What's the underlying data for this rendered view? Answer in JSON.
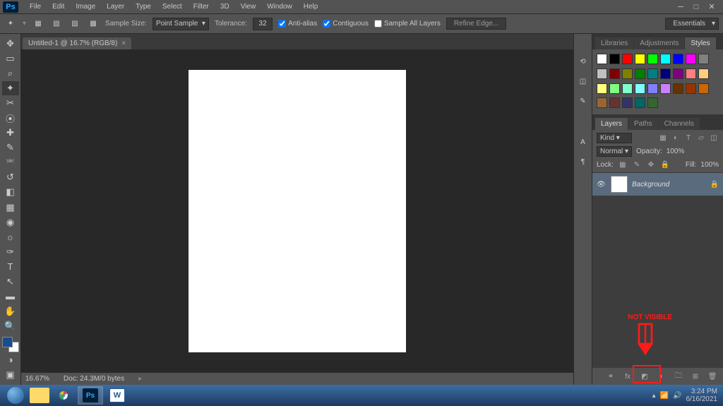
{
  "app": {
    "logo": "Ps"
  },
  "menu": [
    "File",
    "Edit",
    "Image",
    "Layer",
    "Type",
    "Select",
    "Filter",
    "3D",
    "View",
    "Window",
    "Help"
  ],
  "options": {
    "sample_size_label": "Sample Size:",
    "sample_size_value": "Point Sample",
    "tolerance_label": "Tolerance:",
    "tolerance_value": "32",
    "anti_alias": "Anti-alias",
    "contiguous": "Contiguous",
    "sample_all": "Sample All Layers",
    "refine_edge": "Refine Edge...",
    "workspace": "Essentials"
  },
  "document": {
    "tab": "Untitled-1 @ 16.7% (RGB/8)",
    "zoom": "16.67%",
    "doc_info": "Doc: 24.3M/0 bytes"
  },
  "panels": {
    "swatches_tabs": [
      "Libraries",
      "Adjustments",
      "Styles"
    ],
    "swatches_colors": [
      "#ffffff",
      "#000000",
      "#ff0000",
      "#ffff00",
      "#00ff00",
      "#00ffff",
      "#0000ff",
      "#ff00ff",
      "#808080",
      "#c0c0c0",
      "#800000",
      "#808000",
      "#008000",
      "#008080",
      "#000080",
      "#800080",
      "#ff8080",
      "#ffcc80",
      "#ffff80",
      "#80ff80",
      "#80ffcc",
      "#80ffff",
      "#8080ff",
      "#cc80ff",
      "#663300",
      "#993300",
      "#cc6600",
      "#996633",
      "#663333",
      "#333366",
      "#006666",
      "#336633"
    ],
    "layers_tabs": [
      "Layers",
      "Paths",
      "Channels"
    ],
    "kind_label": "Kind",
    "blend_mode": "Normal",
    "opacity_label": "Opacity:",
    "opacity_value": "100%",
    "lock_label": "Lock:",
    "fill_label": "Fill:",
    "fill_value": "100%",
    "layer_name": "Background"
  },
  "annotation": {
    "text": "NOT VISIBLE"
  },
  "taskbar": {
    "time": "3:24 PM",
    "date": "6/16/2021"
  }
}
